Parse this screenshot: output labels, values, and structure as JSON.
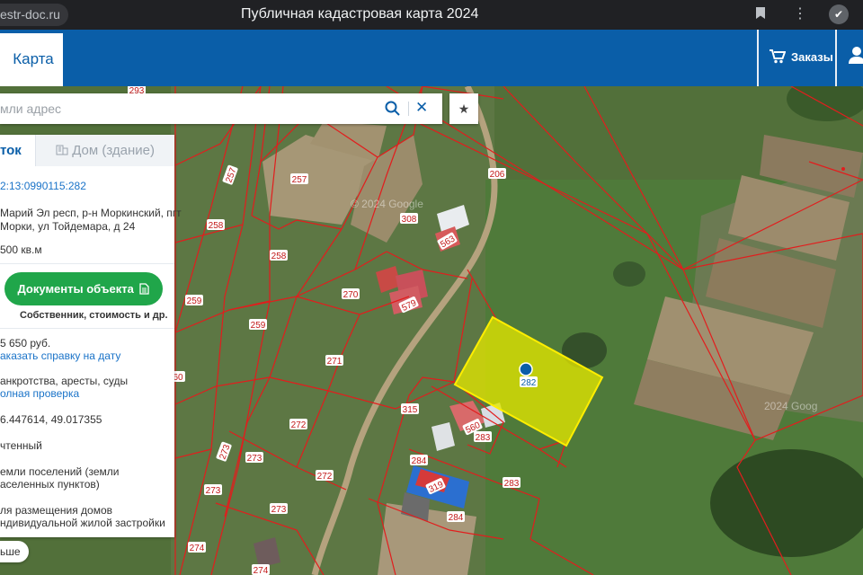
{
  "browser": {
    "url_text": "estr-doc.ru",
    "window_title": "Публичная кадастровая карта 2024"
  },
  "header": {
    "map_tab": "Карта",
    "orders_label": "Заказы"
  },
  "search": {
    "placeholder": "мли адрес"
  },
  "panel": {
    "tab_parcel": "ток",
    "tab_house": "Дом (здание)",
    "cadastral_number": "2:13:0990115:282",
    "address_line1": "Марий Эл респ, р-н Моркинский, пгт",
    "address_line2": "Морки, ул Тойдемара, д 24",
    "area": "500 кв.м",
    "docs_button": "Документы объекта",
    "docs_sub": "Собственник, стоимость и др.",
    "cost": "5 650 руб.",
    "order_report": "аказать справку на дату",
    "bankruptcy": "анкротства, аресты, суды",
    "full_check": "олная проверка",
    "coords": "6.447614, 49.017355",
    "status": "чтенный",
    "category_line1": "емли поселений (земли",
    "category_line2": "аселенных пунктов)",
    "use_line1": "ля размещения домов",
    "use_line2": "ндивидуальной жилой застройки",
    "more_button": "ьше"
  },
  "map": {
    "watermark": "© 2024 Google",
    "watermark2": "2024 Goog",
    "parcel_labels": [
      "293",
      "257",
      "257",
      "206",
      "308",
      "563",
      "258",
      "258",
      "270",
      "579",
      "259",
      "259",
      "271",
      "282",
      "560",
      "315",
      "283",
      "272",
      "272",
      "284",
      "273",
      "319",
      "283",
      "273",
      "273",
      "284",
      "273",
      "274",
      "274",
      "60"
    ]
  }
}
